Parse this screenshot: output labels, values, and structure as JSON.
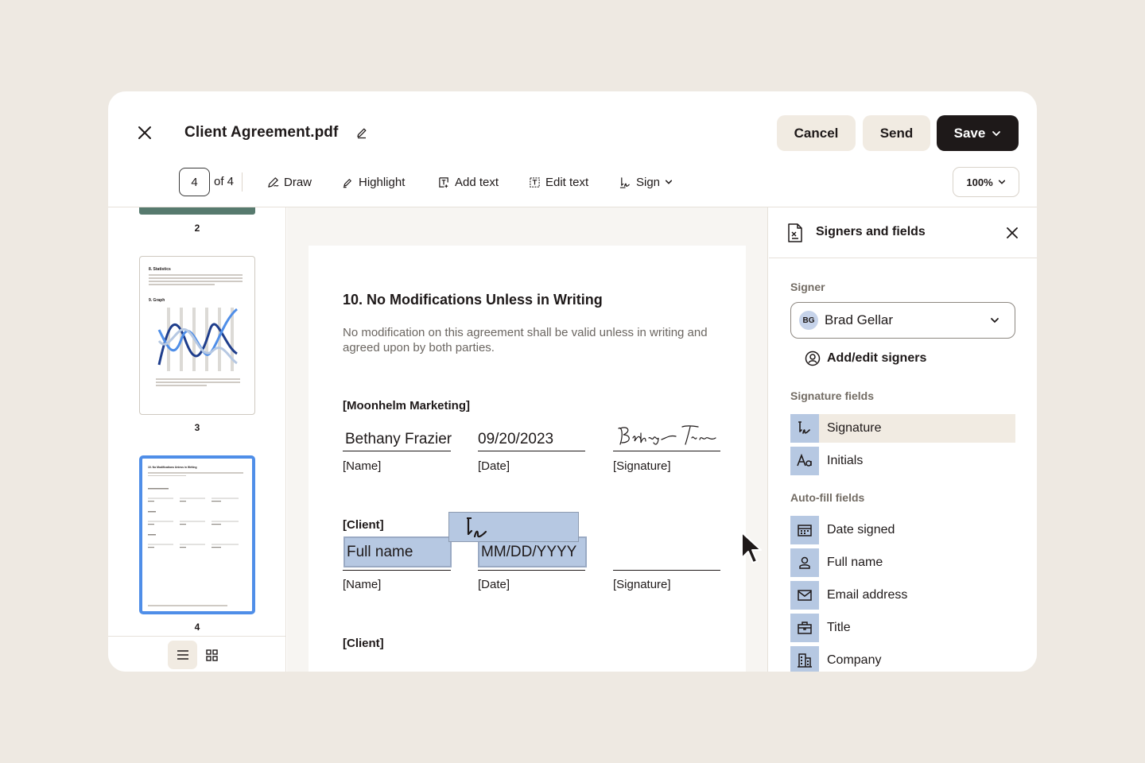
{
  "header": {
    "document_title": "Client Agreement.pdf",
    "cancel_label": "Cancel",
    "send_label": "Send",
    "save_label": "Save"
  },
  "toolbar": {
    "current_page": "4",
    "page_of": "of 4",
    "tools": [
      {
        "label": "Draw",
        "icon": "draw-icon"
      },
      {
        "label": "Highlight",
        "icon": "highlighter-icon"
      },
      {
        "label": "Add text",
        "icon": "add-text-icon"
      },
      {
        "label": "Edit text",
        "icon": "edit-text-icon"
      },
      {
        "label": "Sign",
        "icon": "sign-icon"
      }
    ],
    "zoom": "100%"
  },
  "thumbnails": {
    "pages": [
      "2",
      "3",
      "4"
    ],
    "page3": {
      "heading1": "8. Statistics",
      "heading2": "9. Graph"
    },
    "page4": {
      "heading": "10. No Modifications Unless in Writing"
    }
  },
  "document": {
    "heading": "10. No Modifications Unless in Writing",
    "paragraph": "No modification on this agreement shall be valid unless in writing and agreed upon by both parties.",
    "party1": "[Moonhelm Marketing]",
    "party1_name": "Bethany Frazier",
    "party1_date": "09/20/2023",
    "party2": "[Client]",
    "party2_name_placeholder": "Full name",
    "party2_date_placeholder": "MM/DD/YYYY",
    "party3": "[Client]",
    "label_name": "[Name]",
    "label_date": "[Date]",
    "label_signature": "[Signature]"
  },
  "panel": {
    "title": "Signers and fields",
    "signer_label": "Signer",
    "signer_initials": "BG",
    "signer_name": "Brad Gellar",
    "add_signers": "Add/edit signers",
    "signature_fields_label": "Signature fields",
    "signature_fields": [
      {
        "label": "Signature",
        "icon": "signature-icon"
      },
      {
        "label": "Initials",
        "icon": "initials-icon"
      }
    ],
    "autofill_label": "Auto-fill fields",
    "autofill_fields": [
      {
        "label": "Date signed",
        "icon": "calendar-icon"
      },
      {
        "label": "Full name",
        "icon": "person-icon"
      },
      {
        "label": "Email address",
        "icon": "envelope-icon"
      },
      {
        "label": "Title",
        "icon": "briefcase-icon"
      },
      {
        "label": "Company",
        "icon": "building-icon"
      }
    ]
  },
  "colors": {
    "field_fill": "#b6c8e2",
    "active_thumb": "#4f8ee8",
    "save_bg": "#1e1919",
    "beige_button": "#f1ebe2"
  }
}
